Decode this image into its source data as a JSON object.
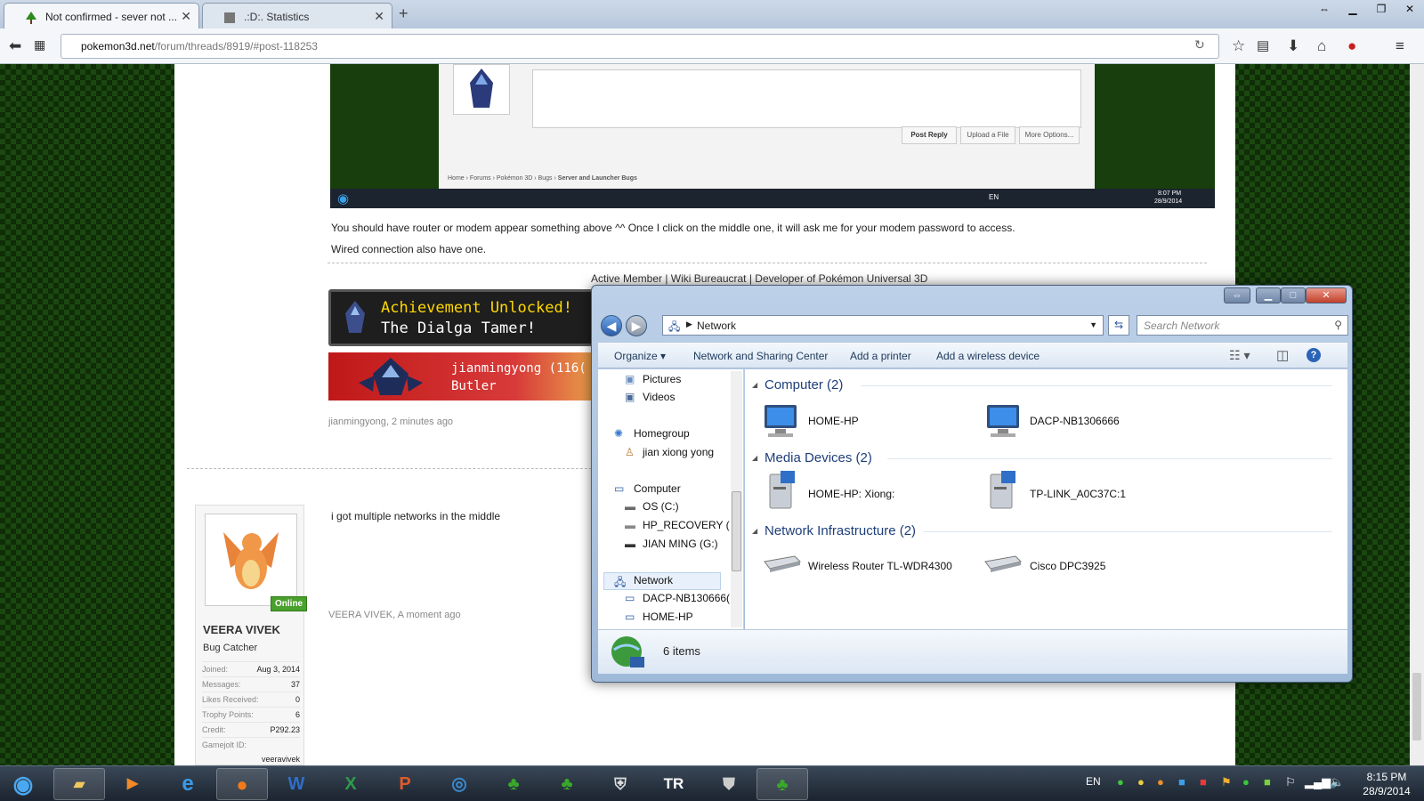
{
  "browser": {
    "tabs": [
      {
        "title": "Not confirmed - sever not ...",
        "active": true
      },
      {
        "title": ".:D:. Statistics",
        "active": false
      }
    ],
    "url_domain": "pokemon3d.net",
    "url_path": "/forum/threads/8919/#post-118253"
  },
  "screenshot_post": {
    "buttons": [
      "Post Reply",
      "Upload a File",
      "More Options..."
    ],
    "breadcrumb": [
      "Home",
      "Forums",
      "Pokémon 3D",
      "Bugs",
      "Server and Launcher Bugs"
    ],
    "taskbar_lang": "EN",
    "taskbar_time": "8:07 PM",
    "taskbar_date": "28/9/2014"
  },
  "post1": {
    "line1": "You should have router or modem appear something above ^^ Once I click on the middle one, it will ask me for your modem password to access.",
    "line2": "Wired connection also have one.",
    "signature": "Active Member | Wiki Bureaucrat | Developer of Pokémon Universal 3D",
    "achievement_line1": "Achievement Unlocked!",
    "achievement_line2": "The Dialga Tamer!",
    "banner_name": "jianmingyong (116(",
    "banner_role": "Butler",
    "author": "jianmingyong",
    "time": "2 minutes ago"
  },
  "post2": {
    "text": "i got multiple networks in the middle",
    "author": "VEERA VIVEK",
    "time": "A moment ago",
    "user": {
      "name": "VEERA VIVEK",
      "title": "Bug Catcher",
      "online_badge": "Online",
      "stats": [
        {
          "k": "Joined:",
          "v": "Aug 3, 2014"
        },
        {
          "k": "Messages:",
          "v": "37"
        },
        {
          "k": "Likes Received:",
          "v": "0"
        },
        {
          "k": "Trophy Points:",
          "v": "6"
        },
        {
          "k": "Credit:",
          "v": "P292.23"
        },
        {
          "k": "Gamejolt ID:",
          "v": ""
        }
      ],
      "gamejolt": "veeravivek"
    }
  },
  "explorer": {
    "address": "Network",
    "search_placeholder": "Search Network",
    "commands": [
      "Organize",
      "Network and Sharing Center",
      "Add a printer",
      "Add a wireless device"
    ],
    "nav": {
      "pictures": "Pictures",
      "videos": "Videos",
      "homegroup": "Homegroup",
      "user": "jian xiong yong",
      "computer": "Computer",
      "os": "OS (C:)",
      "recovery": "HP_RECOVERY (",
      "jian": "JIAN MING (G:)",
      "network": "Network",
      "dacp": "DACP-NB130666(",
      "homehp": "HOME-HP"
    },
    "groups": [
      {
        "name": "Computer (2)",
        "items": [
          "HOME-HP",
          "DACP-NB1306666"
        ]
      },
      {
        "name": "Media Devices (2)",
        "items": [
          "HOME-HP: Xiong:",
          "TP-LINK_A0C37C:1"
        ]
      },
      {
        "name": "Network Infrastructure (2)",
        "items": [
          "Wireless Router TL-WDR4300",
          "Cisco DPC3925"
        ]
      }
    ],
    "status": "6 items"
  },
  "taskbar": {
    "lang": "EN",
    "time": "8:15 PM",
    "date": "28/9/2014"
  },
  "colors": {
    "accent": "#1e3f7a",
    "online": "#4aa02c",
    "achievement": "#ffd800"
  }
}
